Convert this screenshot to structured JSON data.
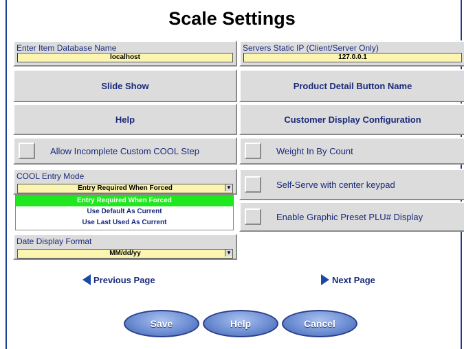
{
  "title": "Scale Settings",
  "fields": {
    "db_name": {
      "label": "Enter Item Database Name",
      "value": "localhost"
    },
    "server_ip": {
      "label": "Servers Static IP (Client/Server Only)",
      "value": "127.0.0.1"
    }
  },
  "buttons": {
    "slide_show": "Slide Show",
    "product_detail": "Product Detail Button Name",
    "help": "Help",
    "customer_display": "Customer Display Configuration"
  },
  "checkboxes": {
    "allow_incomplete": "Allow Incomplete Custom COOL Step",
    "weight_in_count": "Weight In By Count",
    "self_serve": "Self-Serve with center keypad",
    "graphic_preset": "Enable Graphic Preset PLU# Display"
  },
  "cool_entry": {
    "label": "COOL Entry Mode",
    "value": "Entry Required When Forced",
    "options": [
      "Entry Required When Forced",
      "Use Default As Current",
      "Use Last Used As Current"
    ]
  },
  "date_format": {
    "label": "Date Display Format",
    "value": "MM/dd/yy"
  },
  "nav": {
    "previous": "Previous Page",
    "next": "Next Page"
  },
  "footer": {
    "save": "Save",
    "help": "Help",
    "cancel": "Cancel"
  }
}
